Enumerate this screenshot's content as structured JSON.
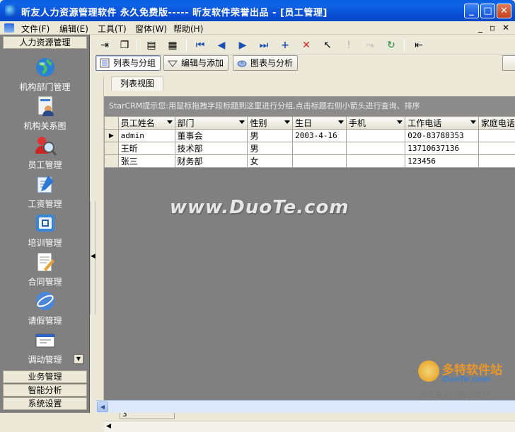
{
  "window": {
    "title": "昕友人力资源管理软件 永久免费版----- 昕友软件荣誉出品  - [员工管理]",
    "buttons": {
      "minimize": "_",
      "maximize": "□",
      "close": "✕"
    }
  },
  "menubar": {
    "items": [
      "文件(F)",
      "编辑(E)",
      "工具(T)",
      "窗体(W)",
      "帮助(H)"
    ],
    "mdi_controls": [
      "_",
      "▫",
      "✕"
    ]
  },
  "nav": {
    "groups": [
      {
        "label": "人力资源管理"
      },
      {
        "label": "业务管理"
      },
      {
        "label": "智能分析"
      },
      {
        "label": "系统设置"
      }
    ],
    "items": [
      {
        "label": "机构部门管理",
        "icon": "globe-icon"
      },
      {
        "label": "机构关系图",
        "icon": "org-chart-icon"
      },
      {
        "label": "员工管理",
        "icon": "employee-search-icon"
      },
      {
        "label": "工资管理",
        "icon": "salary-icon"
      },
      {
        "label": "培训管理",
        "icon": "training-icon"
      },
      {
        "label": "合同管理",
        "icon": "contract-icon"
      },
      {
        "label": "请假管理",
        "icon": "leave-icon"
      },
      {
        "label": "调动管理",
        "icon": "transfer-icon"
      }
    ]
  },
  "view_tabs": [
    {
      "label": "列表与分组",
      "icon": "list-icon",
      "active": true
    },
    {
      "label": "编辑与添加",
      "icon": "edit-icon",
      "active": false
    },
    {
      "label": "图表与分析",
      "icon": "chart-icon",
      "active": false
    }
  ],
  "panel": {
    "tab": "列表视图",
    "hint": "StarCRM提示您:用鼠标拖拽字段标题到这里进行分组,点击标题右侧小箭头进行查询、排序"
  },
  "grid": {
    "columns": [
      "员工姓名",
      "部门",
      "性别",
      "生日",
      "手机",
      "工作电话",
      "家庭电话"
    ],
    "rows": [
      [
        "admin",
        "董事会",
        "男",
        "2003-4-16",
        "",
        "020-83788353",
        ""
      ],
      [
        "王昕",
        "技术部",
        "男",
        "",
        "",
        "13710637136",
        ""
      ],
      [
        "张三",
        "财务部",
        "女",
        "",
        "",
        "123456",
        ""
      ]
    ],
    "current_row_marker": "▶",
    "record_count": "3"
  },
  "watermarks": {
    "center": "www.DuoTe.com",
    "logo_line1": "多特软件站",
    "logo_line2": "DuoTe.com",
    "logo_line3": "国内最安全的软件站"
  }
}
